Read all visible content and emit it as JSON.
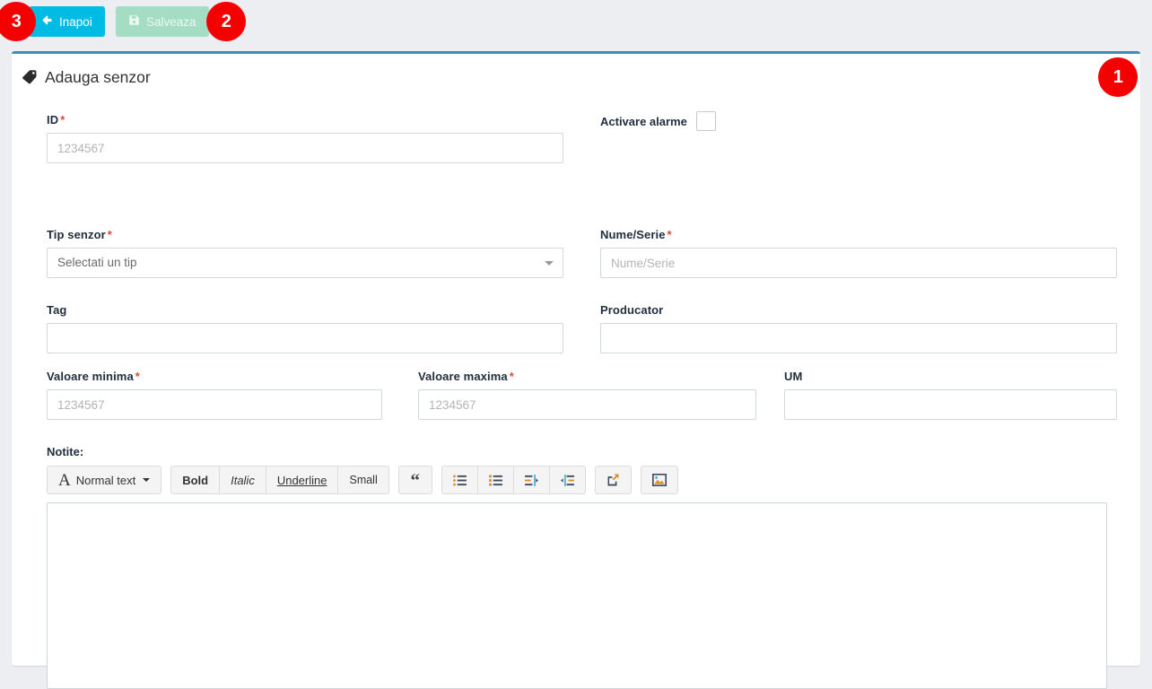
{
  "toolbar_top": {
    "back_label": "Inapoi",
    "back_icon": "arrow-left-icon",
    "back_color": "#00bbe4",
    "save_label": "Salveaza",
    "save_icon": "floppy-save-icon",
    "save_color": "#a5ddc4"
  },
  "annotations": [
    {
      "label": "1"
    },
    {
      "label": "2"
    },
    {
      "label": "3"
    }
  ],
  "panel": {
    "title": "Adauga senzor",
    "title_icon": "tag-icon",
    "accent_color": "#3c8dbc"
  },
  "form": {
    "id": {
      "label": "ID",
      "required": "*",
      "placeholder": "1234567",
      "value": ""
    },
    "activare_alarme": {
      "label": "Activare alarme",
      "checked": false
    },
    "tip_senzor": {
      "label": "Tip senzor",
      "required": "*",
      "selected": "Selectati un tip"
    },
    "nume_serie": {
      "label": "Nume/Serie",
      "required": "*",
      "placeholder": "Nume/Serie",
      "value": ""
    },
    "tag": {
      "label": "Tag",
      "placeholder": "",
      "value": ""
    },
    "producator": {
      "label": "Producator",
      "placeholder": "",
      "value": ""
    },
    "valoare_minima": {
      "label": "Valoare minima",
      "required": "*",
      "placeholder": "1234567",
      "value": ""
    },
    "valoare_maxima": {
      "label": "Valoare maxima",
      "required": "*",
      "placeholder": "1234567",
      "value": ""
    },
    "um": {
      "label": "UM",
      "placeholder": "",
      "value": ""
    },
    "notite": {
      "label": "Notite:",
      "value": ""
    }
  },
  "editor_toolbar": {
    "style_label": "Normal text",
    "style_icon": "letter-a-icon",
    "bold_label": "Bold",
    "italic_label": "Italic",
    "underline_label": "Underline",
    "small_label": "Small",
    "blockquote_icon": "quote-icon",
    "unordered_list_icon": "unordered-list-icon",
    "ordered_list_icon": "ordered-list-icon",
    "outdent_icon": "outdent-icon",
    "indent_icon": "indent-icon",
    "link_icon": "link-icon",
    "image_icon": "image-icon"
  }
}
